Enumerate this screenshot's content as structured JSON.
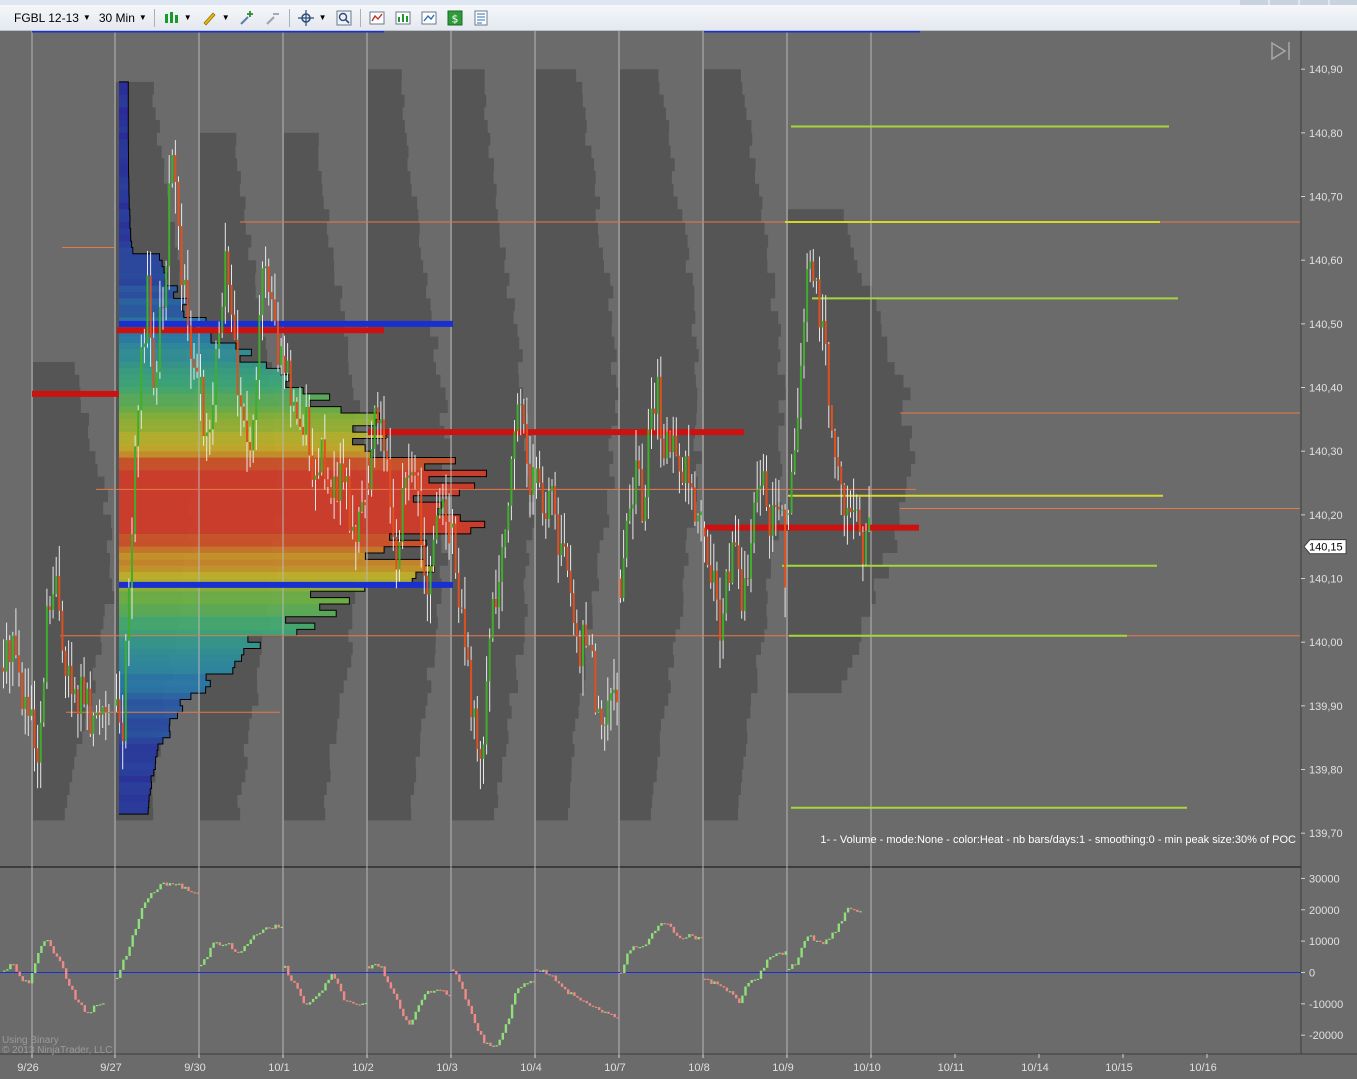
{
  "toolbar": {
    "instrument": "FGBL 12-13",
    "timeframe": "30 Min",
    "icons": [
      "bar-type-icon",
      "draw-pencil-icon",
      "add-indicator-icon",
      "remove-indicator-icon",
      "crosshair-icon",
      "zoom-icon",
      "strategy-icon",
      "data-box-icon",
      "chart-properties-icon",
      "money-icon",
      "properties-list-icon"
    ]
  },
  "chart_data": [
    {
      "type": "candlestick",
      "panel": "price",
      "y_ticks": [
        "140,90",
        "140,80",
        "140,70",
        "140,60",
        "140,50",
        "140,40",
        "140,30",
        "140,20",
        "140,10",
        "140,00",
        "139,90",
        "139,80",
        "139,70"
      ],
      "ylim": [
        139.65,
        140.96
      ],
      "last_price_label": "140,15",
      "last_price": 140.15,
      "x_ticks": [
        "9/26",
        "9/27",
        "9/30",
        "10/1",
        "10/2",
        "10/3",
        "10/4",
        "10/7",
        "10/8",
        "10/9",
        "10/10",
        "10/11",
        "10/14",
        "10/15",
        "10/16"
      ],
      "session_bounds": [
        [
          139.73,
          140.44
        ],
        [
          139.73,
          140.88
        ],
        [
          139.72,
          140.8
        ],
        [
          139.73,
          140.8
        ],
        [
          139.73,
          140.9
        ],
        [
          139.73,
          140.9
        ],
        [
          139.73,
          140.9
        ],
        [
          139.73,
          140.9
        ],
        [
          139.73,
          140.9
        ],
        [
          139.93,
          140.68
        ]
      ],
      "sessions": [
        {
          "label": "9/26",
          "o": 139.96,
          "c": 139.92,
          "h": 140.1,
          "l": 139.73,
          "path": [
            139.96,
            140.02,
            139.92,
            139.88,
            139.78,
            140.05,
            140.08,
            139.98,
            139.9,
            139.93,
            139.86,
            139.9,
            139.92
          ]
        },
        {
          "label": "9/27",
          "o": 139.9,
          "c": 140.39,
          "h": 140.87,
          "l": 139.76,
          "path": [
            139.9,
            139.85,
            140.1,
            140.3,
            140.45,
            140.55,
            140.4,
            140.5,
            140.6,
            140.78,
            140.62,
            140.55,
            140.48,
            140.39
          ]
        },
        {
          "label": "9/30",
          "o": 140.39,
          "c": 140.45,
          "h": 140.67,
          "l": 140.16,
          "path": [
            140.39,
            140.3,
            140.42,
            140.55,
            140.6,
            140.5,
            140.35,
            140.28,
            140.4,
            140.55,
            140.6,
            140.48,
            140.45
          ]
        },
        {
          "label": "10/1",
          "o": 140.45,
          "c": 140.22,
          "h": 140.52,
          "l": 140.16,
          "path": [
            140.45,
            140.38,
            140.3,
            140.36,
            140.25,
            140.32,
            140.2,
            140.24,
            140.28,
            140.2,
            140.18,
            140.22
          ]
        },
        {
          "label": "10/2",
          "o": 140.25,
          "c": 140.18,
          "h": 140.42,
          "l": 139.98,
          "path": [
            140.25,
            140.38,
            140.32,
            140.22,
            140.1,
            140.28,
            140.3,
            140.2,
            140.05,
            140.18,
            140.22,
            140.18
          ]
        },
        {
          "label": "10/3",
          "o": 140.18,
          "c": 140.25,
          "h": 140.4,
          "l": 139.77,
          "path": [
            140.18,
            140.08,
            139.98,
            139.88,
            139.8,
            139.92,
            140.05,
            140.12,
            140.2,
            140.32,
            140.36,
            140.28,
            140.25
          ]
        },
        {
          "label": "10/4",
          "o": 140.25,
          "c": 139.9,
          "h": 140.32,
          "l": 139.83,
          "path": [
            140.25,
            140.2,
            140.28,
            140.12,
            140.15,
            140.05,
            139.98,
            140.02,
            139.92,
            139.88,
            139.93,
            139.9
          ]
        },
        {
          "label": "10/7",
          "o": 140.1,
          "c": 140.22,
          "h": 140.45,
          "l": 140.05,
          "path": [
            140.1,
            140.18,
            140.28,
            140.2,
            140.35,
            140.4,
            140.3,
            140.34,
            140.25,
            140.28,
            140.2,
            140.22
          ]
        },
        {
          "label": "10/8",
          "o": 140.18,
          "c": 140.12,
          "h": 140.35,
          "l": 139.97,
          "path": [
            140.18,
            140.1,
            140.02,
            140.08,
            140.15,
            140.05,
            140.12,
            140.22,
            140.28,
            140.18,
            140.25,
            140.12
          ]
        },
        {
          "label": "10/9",
          "o": 140.2,
          "c": 140.18,
          "h": 140.67,
          "l": 140.11,
          "path": [
            140.2,
            140.3,
            140.45,
            140.6,
            140.55,
            140.5,
            140.38,
            140.3,
            140.22,
            140.25,
            140.18,
            140.15,
            140.18
          ]
        }
      ],
      "price_lines": {
        "blue_value_area_tops": [
          140.96,
          140.96
        ],
        "value_area_high": 140.5,
        "value_area_low": 140.09,
        "poc_lines": [
          140.49,
          140.39,
          140.33,
          140.18
        ],
        "thin_orange_lines": [
          140.66,
          140.62,
          140.36,
          140.24,
          140.21,
          140.01,
          139.89
        ],
        "yellow_green_lines": [
          140.81,
          140.66,
          140.54,
          140.23,
          140.12,
          140.01,
          139.74
        ]
      },
      "annotation": "1-   - Volume - mode:None - color:Heat - nb bars/days:1 - smoothing:0 - min peak size:30% of POC",
      "watermark": [
        "Using Binary",
        "© 2013 NinjaTrader, LLC"
      ]
    },
    {
      "type": "bar",
      "panel": "indicator",
      "y_ticks": [
        "30000",
        "20000",
        "10000",
        "0",
        "-10000",
        "-20000"
      ],
      "ylim": [
        -26000,
        33000
      ],
      "zero_line": 0,
      "sessions": [
        {
          "label": "9/26",
          "path": [
            500,
            3000,
            -2000,
            -3000,
            5000,
            11000,
            6000,
            2000,
            -5000,
            -10000,
            -13000,
            -11000,
            -10000
          ]
        },
        {
          "label": "9/27",
          "path": [
            -2000,
            4000,
            9000,
            16000,
            22000,
            25000,
            27000,
            28000,
            29000,
            28000,
            27000,
            26000,
            25000
          ]
        },
        {
          "label": "9/30",
          "path": [
            2000,
            5000,
            9000,
            10000,
            8000,
            10000,
            7000,
            6000,
            9000,
            10000,
            12000,
            13000,
            14000,
            14000,
            15000,
            15000
          ]
        },
        {
          "label": "10/1",
          "path": [
            1500,
            -2000,
            -5000,
            -9000,
            -11000,
            -8000,
            -6000,
            -4000,
            0,
            -2000,
            -8000,
            -9000,
            -10000,
            -10000,
            -10000
          ]
        },
        {
          "label": "10/2",
          "path": [
            2000,
            3000,
            1000,
            -4000,
            -8000,
            -13000,
            -17000,
            -12000,
            -8000,
            -6000,
            -5000,
            -6000,
            -7000
          ]
        },
        {
          "label": "10/3",
          "path": [
            1000,
            -3000,
            -8000,
            -13000,
            -18000,
            -22000,
            -24000,
            -23000,
            -20000,
            -14000,
            -7000,
            -4000,
            -3000,
            -3000
          ]
        },
        {
          "label": "10/4",
          "path": [
            1000,
            500,
            -1000,
            -4000,
            -6000,
            -7000,
            -9000,
            -10000,
            -11000,
            -13000,
            -13500,
            -14000
          ]
        },
        {
          "label": "10/7",
          "path": [
            0,
            6000,
            9000,
            8000,
            10000,
            13000,
            16000,
            15000,
            12000,
            11000,
            12000,
            11000,
            11000
          ]
        },
        {
          "label": "10/8",
          "path": [
            -2000,
            -3000,
            -4000,
            -5000,
            -7000,
            -10000,
            -4000,
            -3000,
            -1000,
            3000,
            5000,
            6000,
            6000
          ]
        },
        {
          "label": "10/9",
          "path": [
            1000,
            3000,
            8000,
            12000,
            10000,
            9000,
            11000,
            13000,
            16000,
            20000,
            20000,
            19000
          ]
        }
      ]
    }
  ]
}
